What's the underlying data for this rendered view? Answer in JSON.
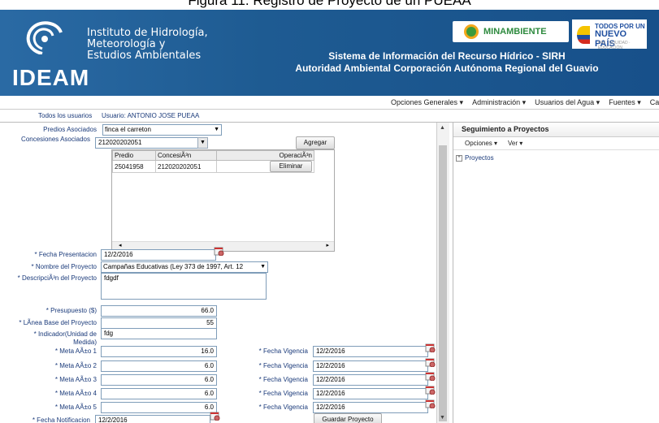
{
  "caption": "Figura 11. Registro de Proyecto de un PUEAA",
  "header": {
    "logo_text": "IDEAM",
    "institute_lines": [
      "Instituto de Hidrología,",
      "Meteorología y",
      "Estudios Ambientales"
    ],
    "system_title": "Sistema de Información del Recurso Hídrico - SIRH",
    "authority_title": "Autoridad Ambiental Corporación Autónoma Regional del Guavio",
    "minambiente": "MINAMBIENTE",
    "todos_line1": "TODOS POR UN",
    "todos_line2": "NUEVO PAÍS",
    "todos_line3": "PAZ · EQUIDAD · EDUCACIÓN"
  },
  "menu": [
    "Opciones Generales ▾",
    "Administración ▾",
    "Usuarios del Agua ▾",
    "Fuentes ▾",
    "Calidad"
  ],
  "userbar": {
    "all_users": "Todos los usuarios",
    "user": "Usuario: ANTONIO JOSE   PUEAA"
  },
  "form": {
    "predios_label": "Predios Asociados",
    "predios_value": "finca el carreton",
    "concesiones_label": "Concesiones Asociados",
    "concesiones_value": "212020202051",
    "agregar_button": "Agregar",
    "grid_headers": [
      "Predio",
      "ConcesiÃ³n",
      "OperaciÃ³n"
    ],
    "grid_rows": [
      {
        "predio": "25041958",
        "concesion": "212020202051",
        "operacion": "Eliminar"
      }
    ],
    "fecha_presentacion_label": "* Fecha Presentacion",
    "fecha_presentacion": "12/2/2016",
    "nombre_proyecto_label": "* Nombre del Proyecto",
    "nombre_proyecto": "Campañas Educativas (Ley 373 de 1997, Art. 12",
    "descripcion_label": "* DescripciÃ³n del Proyecto",
    "descripcion": "fdgdf",
    "presupuesto_label": "* Presupuesto ($)",
    "presupuesto": "66.0",
    "linea_base_label": "* LÃ­nea Base del Proyecto",
    "linea_base": "55",
    "indicador_label_1": "* Indicador(Unidad de",
    "indicador_label_2": "Medida)",
    "indicador": "fdg",
    "metas": [
      {
        "label": "* Meta AÃ±o 1",
        "value": "16.0",
        "vig_label": "* Fecha Vigencia",
        "vig": "12/2/2016"
      },
      {
        "label": "* Meta AÃ±o 2",
        "value": "6.0",
        "vig_label": "* Fecha Vigencia",
        "vig": "12/2/2016"
      },
      {
        "label": "* Meta AÃ±o 3",
        "value": "6.0",
        "vig_label": "* Fecha Vigencia",
        "vig": "12/2/2016"
      },
      {
        "label": "* Meta AÃ±o 4",
        "value": "6.0",
        "vig_label": "* Fecha Vigencia",
        "vig": "12/2/2016"
      },
      {
        "label": "* Meta AÃ±o 5",
        "value": "6.0",
        "vig_label": "* Fecha Vigencia",
        "vig": "12/2/2016"
      }
    ],
    "fecha_notificacion_label": "* Fecha Notificacion",
    "fecha_notificacion": "12/2/2016",
    "guardar_button": "Guardar Proyecto"
  },
  "right_panel": {
    "title": "Seguimiento a Proyectos",
    "opciones": "Opciones ▾",
    "ver": "Ver ▾",
    "tree_item": "Proyectos"
  },
  "colors": {
    "banner": "#1e5b92",
    "label_text": "#1a3a7a"
  }
}
